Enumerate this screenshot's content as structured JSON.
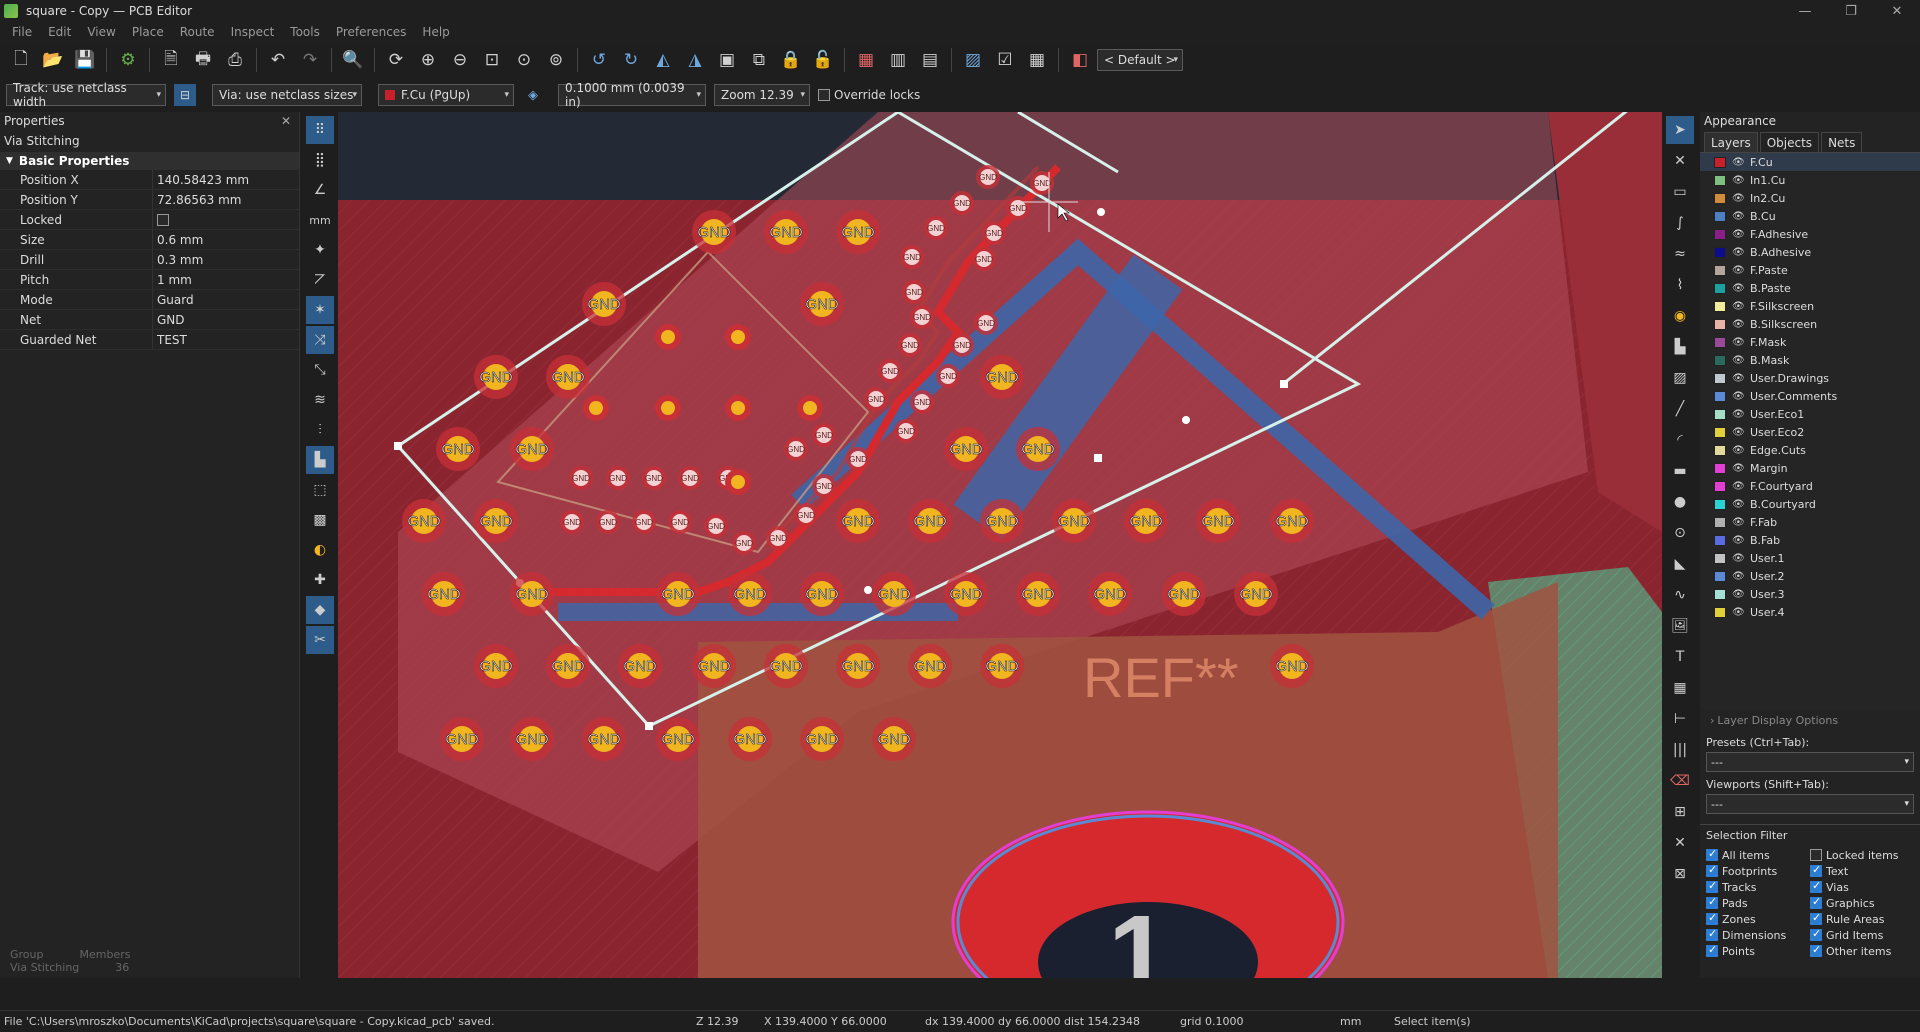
{
  "window": {
    "title": "square - Copy — PCB Editor",
    "controls": [
      "—",
      "❐",
      "✕"
    ]
  },
  "menu": [
    "File",
    "Edit",
    "View",
    "Place",
    "Route",
    "Inspect",
    "Tools",
    "Preferences",
    "Help"
  ],
  "toolbar": {
    "grid_preset": "< Default >"
  },
  "toolbar2": {
    "track": "Track: use netclass width",
    "via": "Via: use netclass sizes",
    "layer": "F.Cu (PgUp)",
    "layer_color": "#c8202a",
    "grid": "0.1000 mm (0.0039 in)",
    "zoom": "Zoom 12.39",
    "override_locks": "Override locks"
  },
  "properties": {
    "header": "Properties",
    "subheader": "Via Stitching",
    "section": "Basic Properties",
    "rows": [
      {
        "key": "Position X",
        "value": "140.58423 mm"
      },
      {
        "key": "Position Y",
        "value": "72.86563 mm"
      },
      {
        "key": "Locked",
        "value": ""
      },
      {
        "key": "Size",
        "value": "0.6 mm"
      },
      {
        "key": "Drill",
        "value": "0.3 mm"
      },
      {
        "key": "Pitch",
        "value": "1 mm"
      },
      {
        "key": "Mode",
        "value": "Guard"
      },
      {
        "key": "Net",
        "value": "GND"
      },
      {
        "key": "Guarded Net",
        "value": "TEST"
      }
    ],
    "footer": {
      "group_label": "Group",
      "members_label": "Members",
      "group_value": "Via Stitching",
      "members_value": "36"
    }
  },
  "canvas": {
    "via_label": "GND",
    "ref_text": "REF**",
    "pad_number": "1",
    "colors": {
      "board": "#8c2a35",
      "zone": "#b5505a",
      "track": "#d6292e",
      "b_track": "#3d66a8",
      "outline": "#cfe9e4",
      "via": "#f1b51f"
    }
  },
  "appearance": {
    "header": "Appearance",
    "tabs": [
      "Layers",
      "Objects",
      "Nets"
    ],
    "layers": [
      {
        "name": "F.Cu",
        "color": "#c8202a"
      },
      {
        "name": "In1.Cu",
        "color": "#7fbf7f"
      },
      {
        "name": "In2.Cu",
        "color": "#d18b3a"
      },
      {
        "name": "B.Cu",
        "color": "#4d7fc4"
      },
      {
        "name": "F.Adhesive",
        "color": "#8a1f8a"
      },
      {
        "name": "B.Adhesive",
        "color": "#0c0c8c"
      },
      {
        "name": "F.Paste",
        "color": "#b5a59a"
      },
      {
        "name": "B.Paste",
        "color": "#1fa0a0"
      },
      {
        "name": "F.Silkscreen",
        "color": "#f0ec9a"
      },
      {
        "name": "B.Silkscreen",
        "color": "#e8b2a7"
      },
      {
        "name": "F.Mask",
        "color": "#9a4a9a"
      },
      {
        "name": "B.Mask",
        "color": "#2a6a5a"
      },
      {
        "name": "User.Drawings",
        "color": "#c2c8d0"
      },
      {
        "name": "User.Comments",
        "color": "#5a8ad6"
      },
      {
        "name": "User.Eco1",
        "color": "#a5e0c6"
      },
      {
        "name": "User.Eco2",
        "color": "#e2d03a"
      },
      {
        "name": "Edge.Cuts",
        "color": "#e3d99c"
      },
      {
        "name": "Margin",
        "color": "#e33ed4"
      },
      {
        "name": "F.Courtyard",
        "color": "#e33ed4"
      },
      {
        "name": "B.Courtyard",
        "color": "#2ad4d4"
      },
      {
        "name": "F.Fab",
        "color": "#b0b0b0"
      },
      {
        "name": "B.Fab",
        "color": "#5a6ae0"
      },
      {
        "name": "User.1",
        "color": "#c2c2c2"
      },
      {
        "name": "User.2",
        "color": "#5a8ad6"
      },
      {
        "name": "User.3",
        "color": "#a5e0d6"
      },
      {
        "name": "User.4",
        "color": "#e2d03a"
      }
    ],
    "layer_display_options": "Layer Display Options",
    "presets_label": "Presets (Ctrl+Tab):",
    "presets_value": "---",
    "viewports_label": "Viewports (Shift+Tab):",
    "viewports_value": "---",
    "selection_filter": {
      "title": "Selection Filter",
      "items": [
        {
          "label": "All items",
          "checked": true
        },
        {
          "label": "Locked items",
          "checked": false
        },
        {
          "label": "Footprints",
          "checked": true
        },
        {
          "label": "Text",
          "checked": true
        },
        {
          "label": "Tracks",
          "checked": true
        },
        {
          "label": "Vias",
          "checked": true
        },
        {
          "label": "Pads",
          "checked": true
        },
        {
          "label": "Graphics",
          "checked": true
        },
        {
          "label": "Zones",
          "checked": true
        },
        {
          "label": "Rule Areas",
          "checked": true
        },
        {
          "label": "Dimensions",
          "checked": true
        },
        {
          "label": "Grid Items",
          "checked": true
        },
        {
          "label": "Points",
          "checked": true
        },
        {
          "label": "Other items",
          "checked": true
        }
      ]
    }
  },
  "status": {
    "message": "File 'C:\\Users\\mroszko\\Documents\\KiCad\\projects\\square\\square - Copy.kicad_pcb' saved.",
    "zoom": "Z 12.39",
    "xy": "X 139.4000  Y 66.0000",
    "delta": "dx 139.4000  dy 66.0000  dist 154.2348",
    "grid": "grid 0.1000",
    "units": "mm",
    "mode": "Select item(s)"
  }
}
